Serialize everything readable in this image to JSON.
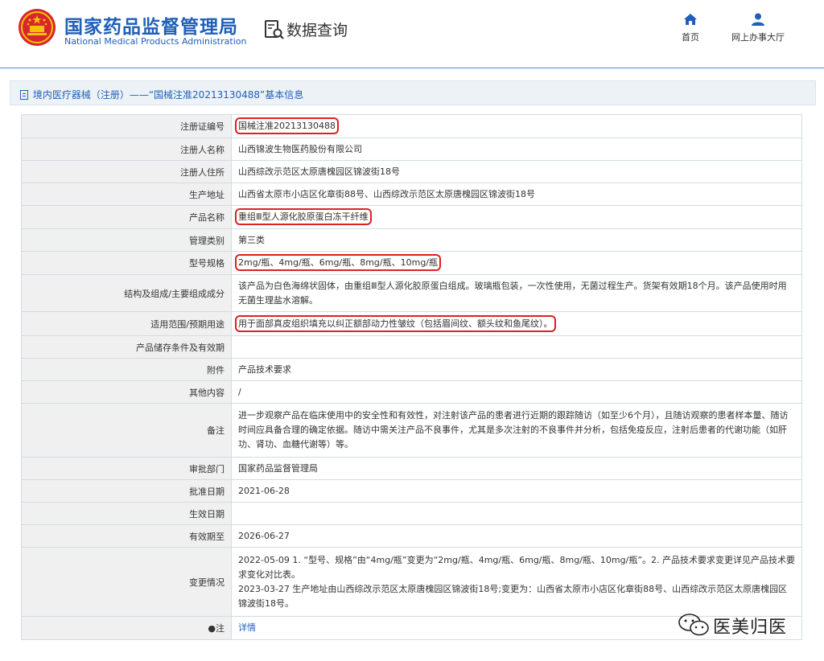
{
  "header": {
    "logo_cn": "国家药品监督管理局",
    "logo_en": "National Medical Products Administration",
    "query_title": "数据查询",
    "nav": [
      {
        "label": "首页",
        "icon": "home-icon"
      },
      {
        "label": "网上办事大厅",
        "icon": "user-icon"
      }
    ],
    "brand_color": "#1f5fb8"
  },
  "section_title": "境内医疗器械（注册）——“国械注准20213130488”基本信息",
  "rows": [
    {
      "label": "注册证编号",
      "value": "国械注准20213130488",
      "highlight": true
    },
    {
      "label": "注册人名称",
      "value": "山西锦波生物医药股份有限公司"
    },
    {
      "label": "注册人住所",
      "value": "山西综改示范区太原唐槐园区锦波街18号"
    },
    {
      "label": "生产地址",
      "value": "山西省太原市小店区化章街88号、山西综改示范区太原唐槐园区锦波街18号"
    },
    {
      "label": "产品名称",
      "value": "重组Ⅲ型人源化胶原蛋白冻干纤维",
      "highlight": true
    },
    {
      "label": "管理类别",
      "value": "第三类"
    },
    {
      "label": "型号规格",
      "value": "2mg/瓶、4mg/瓶、6mg/瓶、8mg/瓶、10mg/瓶",
      "highlight": true
    },
    {
      "label": "结构及组成/主要组成成分",
      "value": "该产品为白色海绵状固体，由重组Ⅲ型人源化胶原蛋白组成。玻璃瓶包装，一次性使用，无菌过程生产。货架有效期18个月。该产品使用时用无菌生理盐水溶解。"
    },
    {
      "label": "适用范围/预期用途",
      "value": "用于面部真皮组织填充以纠正额部动力性皱纹（包括眉间纹、额头纹和鱼尾纹）。",
      "highlight": true
    },
    {
      "label": "产品储存条件及有效期",
      "value": ""
    },
    {
      "label": "附件",
      "value": "产品技术要求"
    },
    {
      "label": "其他内容",
      "value": "/"
    },
    {
      "label": "备注",
      "value": "进一步观察产品在临床使用中的安全性和有效性，对注射该产品的患者进行近期的跟踪随访（如至少6个月），且随访观察的患者样本量、随访时间应具备合理的确定依据。随访中需关注产品不良事件，尤其是多次注射的不良事件并分析，包括免疫反应，注射后患者的代谢功能（如肝功、肾功、血糖代谢等）等。"
    },
    {
      "label": "审批部门",
      "value": "国家药品监督管理局"
    },
    {
      "label": "批准日期",
      "value": "2021-06-28"
    },
    {
      "label": "生效日期",
      "value": ""
    },
    {
      "label": "有效期至",
      "value": "2026-06-27"
    },
    {
      "label": "变更情况",
      "value_lines": [
        "2022-05-09 1. “型号、规格”由“4mg/瓶”变更为“2mg/瓶、4mg/瓶、6mg/瓶、8mg/瓶、10mg/瓶”。2. 产品技术要求变更详见产品技术要求变化对比表。",
        "2023-03-27 生产地址由山西综改示范区太原唐槐园区锦波街18号;变更为：山西省太原市小店区化章街88号、山西综改示范区太原唐槐园区锦波街18号。"
      ]
    },
    {
      "label": "●注",
      "value": "详情",
      "link": true
    }
  ],
  "watermark": "医美归医"
}
